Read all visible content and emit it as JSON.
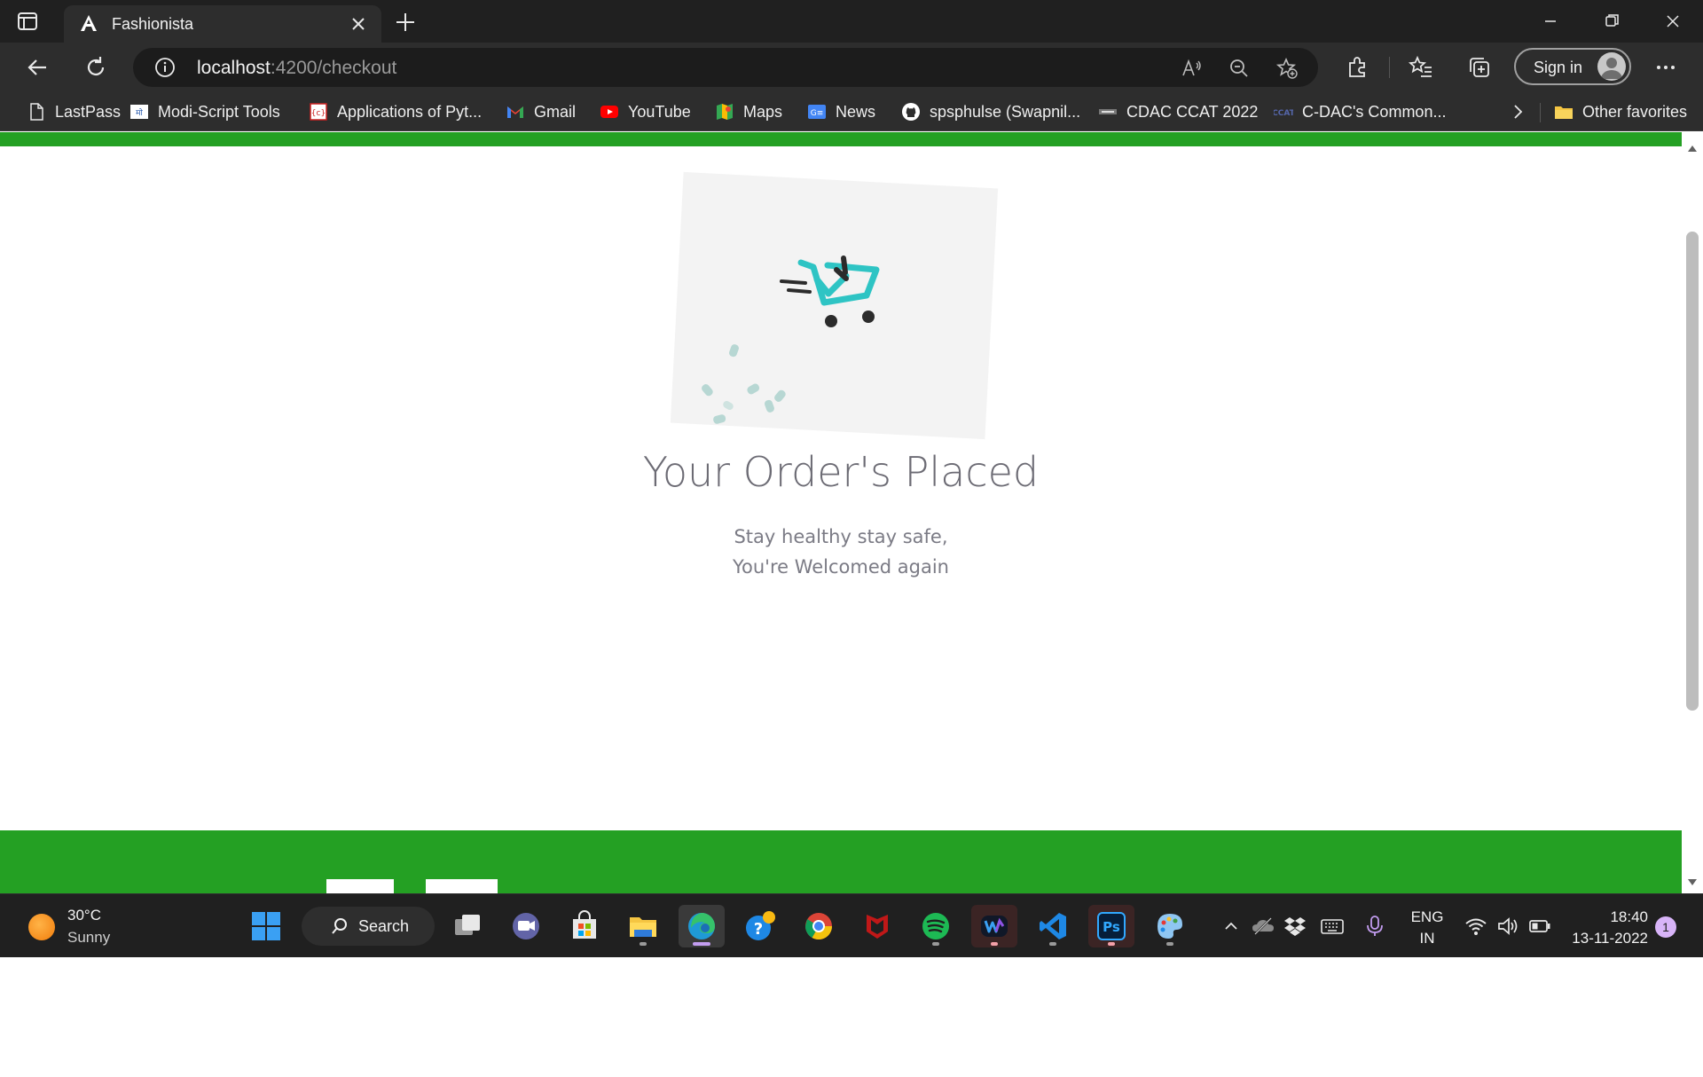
{
  "browser": {
    "tab": {
      "title": "Fashionista"
    },
    "address": {
      "host": "localhost",
      "path": ":4200/checkout"
    },
    "signin_label": "Sign in",
    "bookmarks": [
      {
        "label": "LastPass",
        "icon": "document-icon"
      },
      {
        "label": "Modi-Script Tools",
        "icon": "modi-script-icon"
      },
      {
        "label": "Applications of Pyt...",
        "icon": "code-page-icon"
      },
      {
        "label": "Gmail",
        "icon": "gmail-icon"
      },
      {
        "label": "YouTube",
        "icon": "youtube-icon"
      },
      {
        "label": "Maps",
        "icon": "maps-icon"
      },
      {
        "label": "News",
        "icon": "news-icon"
      },
      {
        "label": "spsphulse (Swapnil...",
        "icon": "github-icon"
      },
      {
        "label": "CDAC CCAT 2022",
        "icon": "cdac-icon"
      },
      {
        "label": "C-DAC's Common...",
        "icon": "ccat-icon"
      }
    ],
    "other_favorites": "Other favorites"
  },
  "page": {
    "headline": "Your Order's Placed",
    "subline1": "Stay healthy stay safe,",
    "subline2": "You're Welcomed again",
    "colors": {
      "accent_green": "#24a023",
      "cart_teal": "#2ec4c4",
      "text_gray": "#6c6b74"
    }
  },
  "taskbar": {
    "weather": {
      "temp": "30°C",
      "condition": "Sunny"
    },
    "search_label": "Search",
    "lang_line1": "ENG",
    "lang_line2": "IN",
    "time": "18:40",
    "date": "13-11-2022",
    "notification_count": "1",
    "apps": [
      "start",
      "search",
      "task-view",
      "teams",
      "store",
      "file-explorer",
      "edge",
      "help",
      "chrome",
      "mcafee",
      "spotify",
      "webex",
      "vscode",
      "photoshop",
      "paint"
    ]
  }
}
